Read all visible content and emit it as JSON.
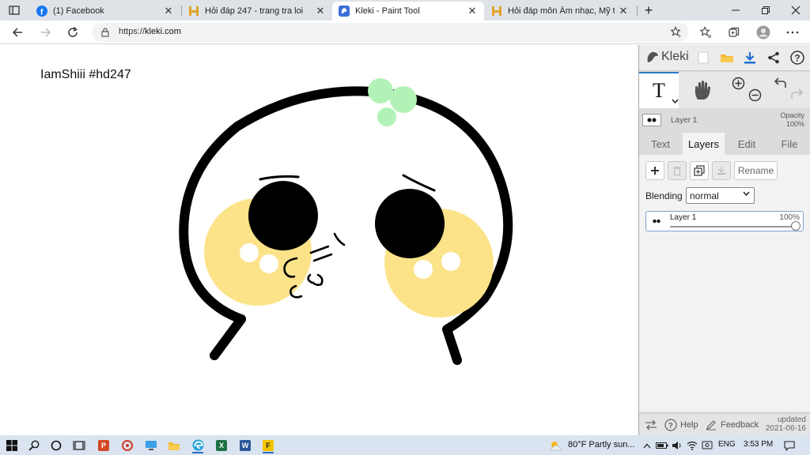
{
  "browser": {
    "tabs": [
      {
        "title": "(1) Facebook",
        "favicon": "facebook-icon",
        "active": false
      },
      {
        "title": "Hỏi đáp 247 - trang tra loi",
        "favicon": "hoidap-icon",
        "active": false
      },
      {
        "title": "Kleki - Paint Tool",
        "favicon": "kleki-icon",
        "active": true
      },
      {
        "title": "Hỏi đáp môn Âm nhạc, Mỹ thuật",
        "favicon": "hoidap-icon",
        "active": false
      }
    ],
    "close_glyph": "✕",
    "new_tab_glyph": "+",
    "url_scheme": "https://",
    "url_host": "kleki.com"
  },
  "canvas": {
    "signature": "IamShiii #hd247"
  },
  "panel": {
    "brand": "Kleki",
    "text_tool_label": "T",
    "layer_name": "Layer 1",
    "opacity_label": "Opacity",
    "opacity_value": "100%",
    "tabs": [
      "Text",
      "Layers",
      "Edit",
      "File"
    ],
    "active_tab": "Layers",
    "rename_label": "Rename",
    "blending_label": "Blending",
    "blending_value": "normal",
    "layers": [
      {
        "name": "Layer 1",
        "opacity": "100%",
        "opacity_fraction": 1.0
      }
    ],
    "help_label": "Help",
    "feedback_label": "Feedback",
    "updated_label": "updated",
    "updated_date": "2021-06-16"
  },
  "taskbar": {
    "apps": [
      "windows-start",
      "search",
      "cortana",
      "task-view",
      "powerpoint",
      "unknown-red-app",
      "pc",
      "file-explorer",
      "edge",
      "excel",
      "word",
      "f-app"
    ],
    "weather": "80°F  Partly sun...",
    "language": "ENG",
    "time": "3:53 PM"
  },
  "colors": {
    "tab_bar": "#dfe3e8",
    "panel_bg": "#dcdcdc",
    "accent_blue": "#2b78c5",
    "cheek_yellow": "#fce38a",
    "sprout_green": "#b3f2b6"
  }
}
